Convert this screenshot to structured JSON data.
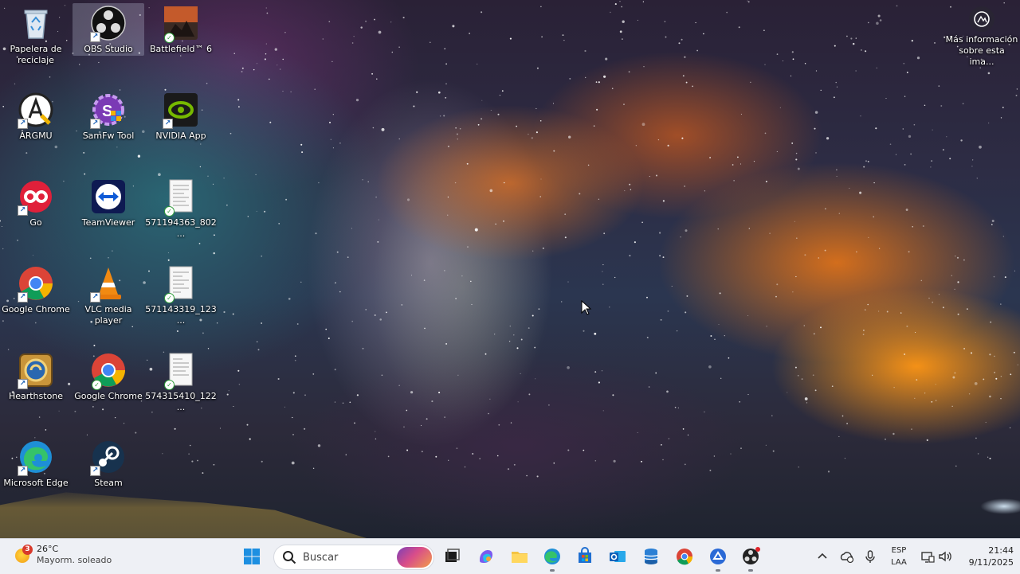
{
  "desktop": {
    "icons": [
      {
        "label": "Papelera de reciclaje",
        "icon": "recycle-bin-icon"
      },
      {
        "label": "OBS Studio",
        "icon": "obs-studio-icon",
        "selected": true
      },
      {
        "label": "Battlefield™ 6",
        "icon": "battlefield-icon"
      },
      {
        "label": "ARGMU",
        "icon": "argmu-icon"
      },
      {
        "label": "SamFw Tool",
        "icon": "samfw-tool-icon"
      },
      {
        "label": "NVIDIA App",
        "icon": "nvidia-app-icon"
      },
      {
        "label": "Go",
        "icon": "go-icon"
      },
      {
        "label": "TeamViewer",
        "icon": "teamviewer-icon"
      },
      {
        "label": "571194363_802...",
        "icon": "document-file-icon"
      },
      {
        "label": "Google Chrome",
        "icon": "google-chrome-icon"
      },
      {
        "label": "VLC media player",
        "icon": "vlc-icon"
      },
      {
        "label": "571143319_123...",
        "icon": "document-file-icon"
      },
      {
        "label": "Hearthstone",
        "icon": "hearthstone-icon"
      },
      {
        "label": "Google Chrome",
        "icon": "google-chrome-icon"
      },
      {
        "label": "574315410_122...",
        "icon": "document-file-icon"
      },
      {
        "label": "Microsoft Edge",
        "icon": "microsoft-edge-icon"
      },
      {
        "label": "Steam",
        "icon": "steam-icon"
      }
    ],
    "image_info": {
      "label": "Más información sobre esta ima...",
      "icon": "camera-info-icon"
    }
  },
  "taskbar": {
    "weather": {
      "temperature": "26°C",
      "condition": "Mayorm. soleado",
      "badge_count": "3",
      "icon": "sunny-weather-icon"
    },
    "search": {
      "placeholder": "Buscar",
      "icon": "search-icon"
    },
    "pinned": [
      {
        "name": "start",
        "icon": "windows-start-icon"
      },
      {
        "name": "task-view",
        "icon": "task-view-icon"
      },
      {
        "name": "copilot",
        "icon": "copilot-icon"
      },
      {
        "name": "file-explorer",
        "icon": "folder-icon"
      },
      {
        "name": "microsoft-edge",
        "icon": "microsoft-edge-icon"
      },
      {
        "name": "microsoft-store",
        "icon": "store-icon"
      },
      {
        "name": "outlook",
        "icon": "outlook-icon"
      },
      {
        "name": "database-app",
        "icon": "database-icon"
      },
      {
        "name": "google-chrome",
        "icon": "google-chrome-icon"
      },
      {
        "name": "teams",
        "icon": "teams-icon"
      },
      {
        "name": "obs-studio",
        "icon": "obs-studio-icon"
      }
    ],
    "tray": {
      "language_line1": "ESP",
      "language_line2": "LAA",
      "time": "21:44",
      "date": "9/11/2025"
    }
  }
}
